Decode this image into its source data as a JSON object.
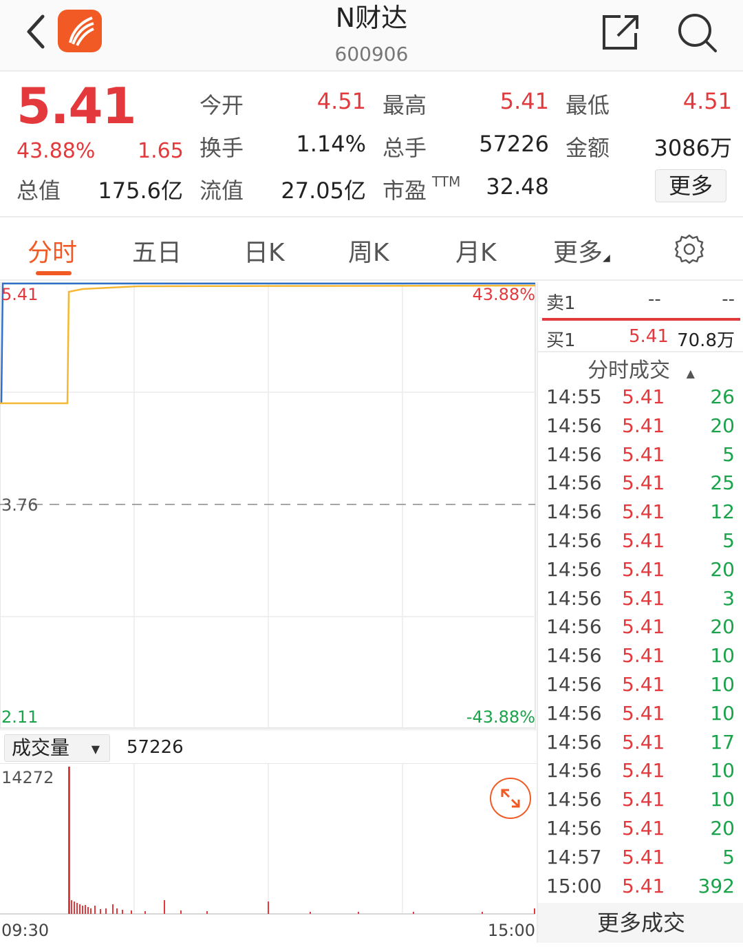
{
  "header": {
    "title": "N财达",
    "code": "600906"
  },
  "quote": {
    "price": "5.41",
    "change_pct": "43.88%",
    "change_amt": "1.65",
    "open_label": "今开",
    "open_value": "4.51",
    "high_label": "最高",
    "high_value": "5.41",
    "low_label": "最低",
    "low_value": "4.51",
    "turnover_label": "换手",
    "turnover_value": "1.14%",
    "volume_label": "总手",
    "volume_value": "57226",
    "amount_label": "金额",
    "amount_value": "3086万",
    "mktcap_label": "总值",
    "mktcap_value": "175.6亿",
    "float_label": "流值",
    "float_value": "27.05亿",
    "pe_label": "市盈",
    "pe_suffix": "TTM",
    "pe_value": "32.48",
    "more_label": "更多"
  },
  "tabs": [
    {
      "label": "分时",
      "active": true
    },
    {
      "label": "五日"
    },
    {
      "label": "日K"
    },
    {
      "label": "周K"
    },
    {
      "label": "月K"
    },
    {
      "label": "更多"
    }
  ],
  "chart": {
    "price_max": "5.41",
    "price_mid": "3.76",
    "price_min": "2.11",
    "pct_max": "43.88%",
    "pct_min": "-43.88%",
    "vol_selector": "成交量",
    "vol_total": "57226",
    "vol_max": "14272",
    "time_start": "09:30",
    "time_end": "15:00",
    "colors": {
      "price_line": "#f5b731",
      "avg_line": "#2e6fc7",
      "up": "#e4393c",
      "down": "#1aa34a",
      "accent": "#f15a24"
    }
  },
  "chart_data": {
    "type": "line",
    "x_range": [
      "09:30",
      "15:00"
    ],
    "ylim": [
      2.11,
      5.41
    ],
    "reference_price": 3.76,
    "series": [
      {
        "values": [
          4.51,
          4.51,
          5.35,
          5.39,
          5.4,
          5.41,
          5.41,
          5.41,
          5.41,
          5.41,
          5.41,
          5.41
        ]
      }
    ],
    "volume_max": 14272
  },
  "orderbook": {
    "ask_label": "卖1",
    "ask_price": "--",
    "ask_vol": "--",
    "bid_label": "买1",
    "bid_price": "5.41",
    "bid_vol": "70.8万"
  },
  "trades": {
    "header": "分时成交",
    "rows": [
      {
        "time": "14:55",
        "price": "5.41",
        "vol": "26"
      },
      {
        "time": "14:56",
        "price": "5.41",
        "vol": "20"
      },
      {
        "time": "14:56",
        "price": "5.41",
        "vol": "5"
      },
      {
        "time": "14:56",
        "price": "5.41",
        "vol": "25"
      },
      {
        "time": "14:56",
        "price": "5.41",
        "vol": "12"
      },
      {
        "time": "14:56",
        "price": "5.41",
        "vol": "5"
      },
      {
        "time": "14:56",
        "price": "5.41",
        "vol": "20"
      },
      {
        "time": "14:56",
        "price": "5.41",
        "vol": "3"
      },
      {
        "time": "14:56",
        "price": "5.41",
        "vol": "20"
      },
      {
        "time": "14:56",
        "price": "5.41",
        "vol": "10"
      },
      {
        "time": "14:56",
        "price": "5.41",
        "vol": "10"
      },
      {
        "time": "14:56",
        "price": "5.41",
        "vol": "10"
      },
      {
        "time": "14:56",
        "price": "5.41",
        "vol": "17"
      },
      {
        "time": "14:56",
        "price": "5.41",
        "vol": "10"
      },
      {
        "time": "14:56",
        "price": "5.41",
        "vol": "10"
      },
      {
        "time": "14:56",
        "price": "5.41",
        "vol": "20"
      },
      {
        "time": "14:57",
        "price": "5.41",
        "vol": "5"
      },
      {
        "time": "15:00",
        "price": "5.41",
        "vol": "392"
      }
    ],
    "more_label": "更多成交"
  }
}
